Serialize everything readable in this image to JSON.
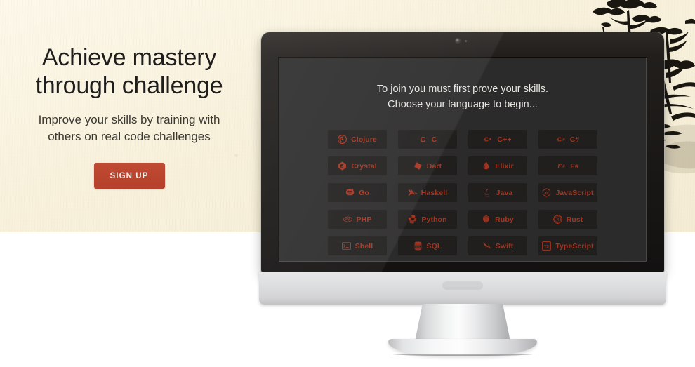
{
  "hero": {
    "headline": "Achieve mastery through challenge",
    "subhead": "Improve your skills by training with others on real code challenges",
    "signup_label": "SIGN UP",
    "background_color": "#f8f1dc",
    "accent_color": "#bb4430"
  },
  "screen": {
    "prompt_line1": "To join you must first prove your skills.",
    "prompt_line2": "Choose your language to begin...",
    "background_color": "#2b2b2b",
    "button_color": "#201f1e",
    "button_text_color": "#a7341f",
    "languages": [
      {
        "label": "Clojure",
        "icon": "clojure-icon"
      },
      {
        "label": "C",
        "icon": "c-icon"
      },
      {
        "label": "C++",
        "icon": "cpp-icon"
      },
      {
        "label": "C#",
        "icon": "csharp-icon"
      },
      {
        "label": "Crystal",
        "icon": "crystal-icon"
      },
      {
        "label": "Dart",
        "icon": "dart-icon"
      },
      {
        "label": "Elixir",
        "icon": "elixir-icon"
      },
      {
        "label": "F#",
        "icon": "fsharp-icon"
      },
      {
        "label": "Go",
        "icon": "go-gopher-icon"
      },
      {
        "label": "Haskell",
        "icon": "haskell-icon"
      },
      {
        "label": "Java",
        "icon": "java-icon"
      },
      {
        "label": "JavaScript",
        "icon": "javascript-icon"
      },
      {
        "label": "PHP",
        "icon": "php-icon"
      },
      {
        "label": "Python",
        "icon": "python-icon"
      },
      {
        "label": "Ruby",
        "icon": "ruby-icon"
      },
      {
        "label": "Rust",
        "icon": "rust-icon"
      },
      {
        "label": "Shell",
        "icon": "shell-terminal-icon"
      },
      {
        "label": "SQL",
        "icon": "sql-database-icon"
      },
      {
        "label": "Swift",
        "icon": "swift-bird-icon"
      },
      {
        "label": "TypeScript",
        "icon": "typescript-icon"
      }
    ]
  },
  "decor": {
    "artwork": "japanese-ink-pine-tree-painting",
    "ink_color": "#17150f"
  }
}
